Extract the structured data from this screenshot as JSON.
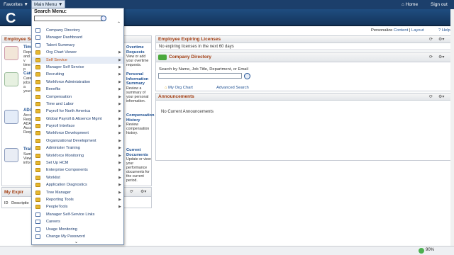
{
  "topbar": {
    "favorites": "Favorites ▼",
    "main_menu": "Main Menu ▼",
    "home": "Home",
    "sign_out": "Sign out"
  },
  "banner": {
    "logo_text": "C"
  },
  "header_right": {
    "personalize_prefix": "Personalize",
    "content": "Content",
    "layout": "Layout",
    "help": "Help",
    "sep": "|"
  },
  "ess_pagelet": {
    "title": "Employee Sel",
    "items": [
      {
        "title": "Time",
        "desc": "Repo and v time p"
      },
      {
        "title": "Care",
        "desc": "Caree jobs a your"
      },
      {
        "title": "ADA",
        "desc": "Acco Requ ADA Acco Requ"
      },
      {
        "title": "Trai",
        "desc": "Sum View infor"
      }
    ],
    "right_links": [
      {
        "title": "Overtime Requests",
        "desc": "View or add your overtime requests."
      },
      {
        "title": "Personal Information Summary",
        "desc": "Review a summary of your personal information."
      },
      {
        "title": "Compensation History",
        "desc": "Review compensation history."
      },
      {
        "title": "Current Documents",
        "desc": "Update or view your performance documents for the current period."
      }
    ]
  },
  "my_expiring": {
    "title": "My Expir",
    "cols": [
      "ID",
      "Descriptio"
    ]
  },
  "expiring_licenses": {
    "title": "Employee Expiring Licenses",
    "message": "No expiring licenses in the next 60 days"
  },
  "company_directory": {
    "title": "Company Directory",
    "search_label": "Search by Name, Job Title, Department, or Email",
    "my_org_chart": "My Org Chart",
    "advanced_search": "Advanced Search"
  },
  "announcements": {
    "title": "Announcements",
    "message": "No Current Announcements"
  },
  "dropdown": {
    "title": "Search Menu:",
    "items": [
      {
        "label": "Company Directory",
        "icon": "doc",
        "arrow": false
      },
      {
        "label": "Manager Dashboard",
        "icon": "doc",
        "arrow": false
      },
      {
        "label": "Talent Summary",
        "icon": "doc",
        "arrow": false
      },
      {
        "label": "Org Chart Viewer",
        "icon": "folder",
        "arrow": true
      },
      {
        "label": "Self Service",
        "icon": "folder",
        "arrow": true,
        "selected": true
      },
      {
        "label": "Manager Self Service",
        "icon": "folder",
        "arrow": true
      },
      {
        "label": "Recruiting",
        "icon": "folder",
        "arrow": true
      },
      {
        "label": "Workforce Administration",
        "icon": "folder",
        "arrow": true
      },
      {
        "label": "Benefits",
        "icon": "folder",
        "arrow": true
      },
      {
        "label": "Compensation",
        "icon": "folder",
        "arrow": true
      },
      {
        "label": "Time and Labor",
        "icon": "folder",
        "arrow": true
      },
      {
        "label": "Payroll for North America",
        "icon": "folder",
        "arrow": true
      },
      {
        "label": "Global Payroll & Absence Mgmt",
        "icon": "folder",
        "arrow": true
      },
      {
        "label": "Payroll Interface",
        "icon": "folder",
        "arrow": true
      },
      {
        "label": "Workforce Development",
        "icon": "folder",
        "arrow": true
      },
      {
        "label": "Organizational Development",
        "icon": "folder",
        "arrow": true
      },
      {
        "label": "Administer Training",
        "icon": "folder",
        "arrow": true
      },
      {
        "label": "Workforce Monitoring",
        "icon": "folder",
        "arrow": true
      },
      {
        "label": "Set Up HCM",
        "icon": "folder",
        "arrow": true
      },
      {
        "label": "Enterprise Components",
        "icon": "folder",
        "arrow": true
      },
      {
        "label": "Worklist",
        "icon": "folder",
        "arrow": true
      },
      {
        "label": "Application Diagnostics",
        "icon": "folder",
        "arrow": true
      },
      {
        "label": "Tree Manager",
        "icon": "folder",
        "arrow": true
      },
      {
        "label": "Reporting Tools",
        "icon": "folder",
        "arrow": true
      },
      {
        "label": "PeopleTools",
        "icon": "folder",
        "arrow": true
      },
      {
        "label": "Manager Self-Service Links",
        "icon": "doc",
        "arrow": false
      },
      {
        "label": "Careers",
        "icon": "doc",
        "arrow": false
      },
      {
        "label": "Usage Monitoring",
        "icon": "doc",
        "arrow": false
      },
      {
        "label": "Change My Password",
        "icon": "doc",
        "arrow": false
      }
    ]
  },
  "status": {
    "zoom": "90%"
  }
}
